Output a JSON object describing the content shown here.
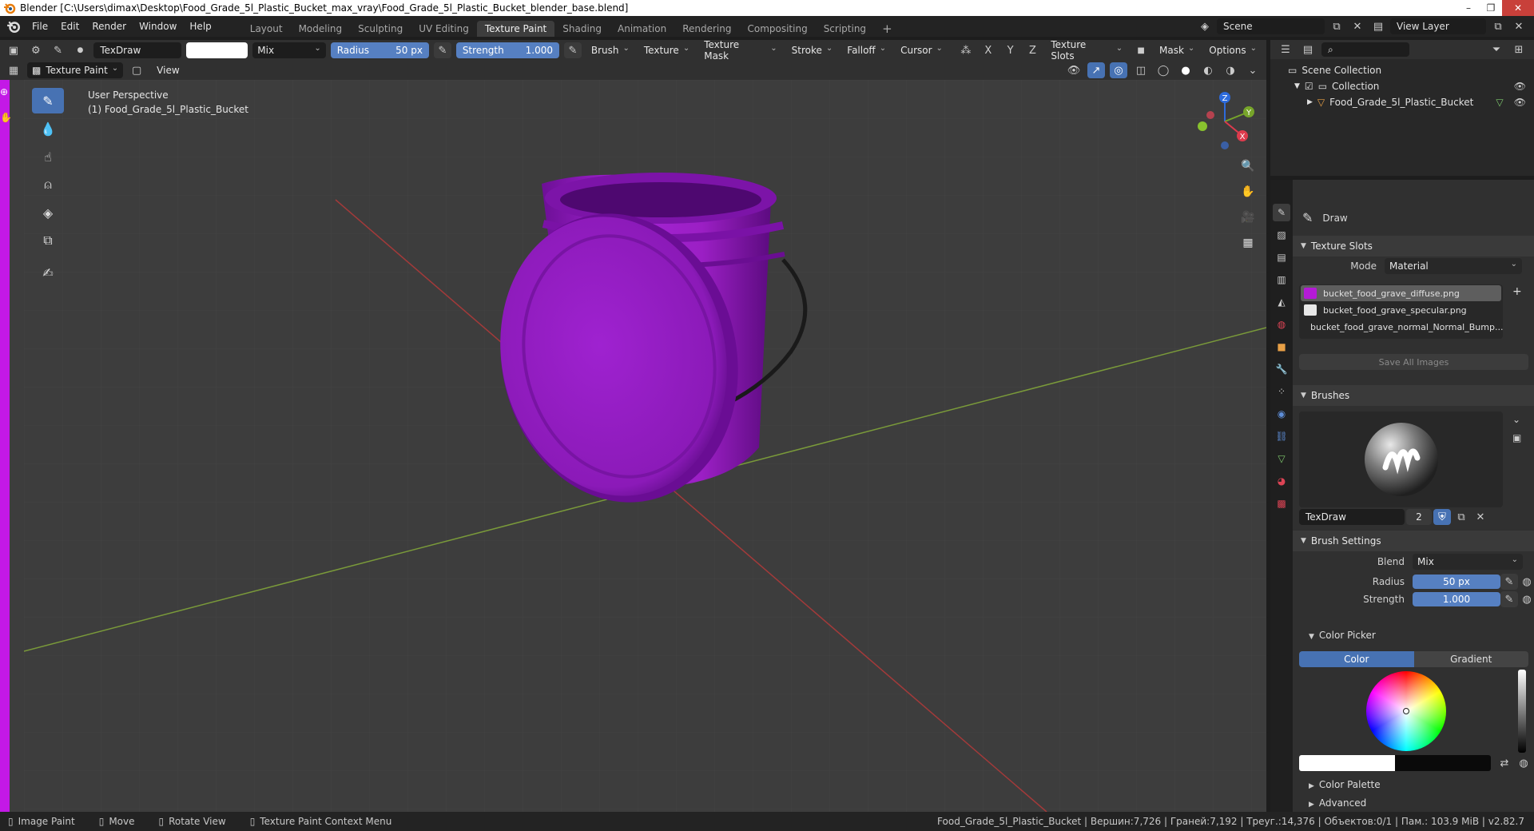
{
  "window": {
    "title": "Blender [C:\\Users\\dimax\\Desktop\\Food_Grade_5l_Plastic_Bucket_max_vray\\Food_Grade_5l_Plastic_Bucket_blender_base.blend]"
  },
  "menu": [
    "File",
    "Edit",
    "Render",
    "Window",
    "Help"
  ],
  "workspaces": [
    {
      "label": "Layout",
      "active": false
    },
    {
      "label": "Modeling",
      "active": false
    },
    {
      "label": "Sculpting",
      "active": false
    },
    {
      "label": "UV Editing",
      "active": false
    },
    {
      "label": "Texture Paint",
      "active": true
    },
    {
      "label": "Shading",
      "active": false
    },
    {
      "label": "Animation",
      "active": false
    },
    {
      "label": "Rendering",
      "active": false
    },
    {
      "label": "Compositing",
      "active": false
    },
    {
      "label": "Scripting",
      "active": false
    }
  ],
  "scene": {
    "name": "Scene",
    "view_layer": "View Layer"
  },
  "tool_header": {
    "brush_name": "TexDraw",
    "blend": "Mix",
    "radius_label": "Radius",
    "radius_value": "50 px",
    "strength_label": "Strength",
    "strength_value": "1.000",
    "menus": [
      "Brush",
      "Texture",
      "Texture Mask",
      "Stroke",
      "Falloff",
      "Cursor"
    ],
    "axes": [
      "X",
      "Y",
      "Z"
    ],
    "texture_slots": "Texture Slots",
    "mask": "Mask",
    "options": "Options"
  },
  "viewport_header": {
    "mode": "Texture Paint",
    "view": "View"
  },
  "viewport": {
    "perspective": "User Perspective",
    "object": "(1) Food_Grade_5l_Plastic_Bucket",
    "gizmo": {
      "z": "Z",
      "y": "Y",
      "x": "X"
    },
    "bucket_color": "#9b1fc4"
  },
  "outliner": {
    "scene_collection": "Scene Collection",
    "collection": "Collection",
    "object": "Food_Grade_5l_Plastic_Bucket"
  },
  "properties": {
    "tool_name": "Draw",
    "texture_slots": {
      "title": "Texture Slots",
      "mode_label": "Mode",
      "mode_value": "Material",
      "slots": [
        {
          "name": "bucket_food_grave_diffuse.png",
          "color": "#b41ad6",
          "active": true
        },
        {
          "name": "bucket_food_grave_specular.png",
          "color": "#e8e8e8",
          "active": false
        },
        {
          "name": "bucket_food_grave_normal_Normal_Bump...",
          "color": "#b9b9f5",
          "active": false
        }
      ],
      "save_all": "Save All Images"
    },
    "brushes": {
      "title": "Brushes",
      "name": "TexDraw",
      "users": "2"
    },
    "brush_settings": {
      "title": "Brush Settings",
      "blend_label": "Blend",
      "blend_value": "Mix",
      "radius_label": "Radius",
      "radius_value": "50 px",
      "strength_label": "Strength",
      "strength_value": "1.000"
    },
    "color_picker": {
      "title": "Color Picker",
      "tab_color": "Color",
      "tab_gradient": "Gradient"
    },
    "color_palette": "Color Palette",
    "advanced": "Advanced"
  },
  "statusbar": {
    "image_paint": "Image Paint",
    "move": "Move",
    "rotate_view": "Rotate View",
    "context_menu": "Texture Paint Context Menu",
    "stats": "Food_Grade_5l_Plastic_Bucket | Вершин:7,726 | Граней:7,192 | Треуг.:14,376 | Объектов:0/1 | Пам.: 103.9 MiB | v2.82.7"
  }
}
